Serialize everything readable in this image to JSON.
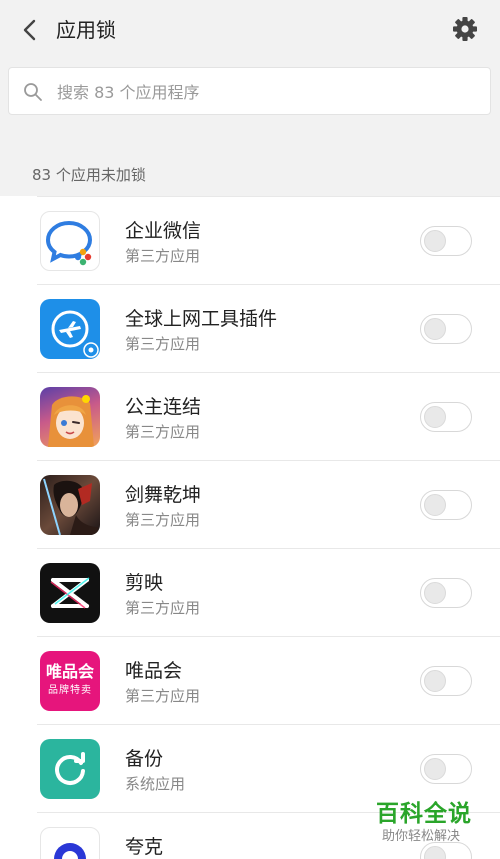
{
  "header": {
    "title": "应用锁"
  },
  "search": {
    "placeholder": "搜索 83 个应用程序"
  },
  "section": {
    "header": "83 个应用未加锁"
  },
  "apps": [
    {
      "name": "企业微信",
      "type": "第三方应用",
      "locked": false,
      "icon": "wecom-icon"
    },
    {
      "name": "全球上网工具插件",
      "type": "第三方应用",
      "locked": false,
      "icon": "global-internet-plugin-icon"
    },
    {
      "name": "公主连结",
      "type": "第三方应用",
      "locked": false,
      "icon": "princess-connect-icon"
    },
    {
      "name": "剑舞乾坤",
      "type": "第三方应用",
      "locked": false,
      "icon": "jianwu-qiankun-icon"
    },
    {
      "name": "剪映",
      "type": "第三方应用",
      "locked": false,
      "icon": "capcut-icon"
    },
    {
      "name": "唯品会",
      "type": "第三方应用",
      "locked": false,
      "icon": "vipshop-icon",
      "icon_text": [
        "唯品会",
        "品牌特卖"
      ]
    },
    {
      "name": "备份",
      "type": "系统应用",
      "locked": false,
      "icon": "backup-icon"
    },
    {
      "name": "夸克",
      "type": "",
      "locked": false,
      "icon": "quark-icon"
    }
  ],
  "watermark": {
    "title": "百科全说",
    "subtitle": "助你轻松解决"
  },
  "colors": {
    "background": "#f2f2f2",
    "watermark_green": "#2aa52a",
    "wecom_blue": "#2f7de1",
    "global_plugin_blue": "#1e8fe8",
    "capcut_bg": "#111111",
    "vipshop_pink": "#e6157c",
    "backup_teal": "#2bb59e",
    "quark_blue": "#2a37d6"
  }
}
